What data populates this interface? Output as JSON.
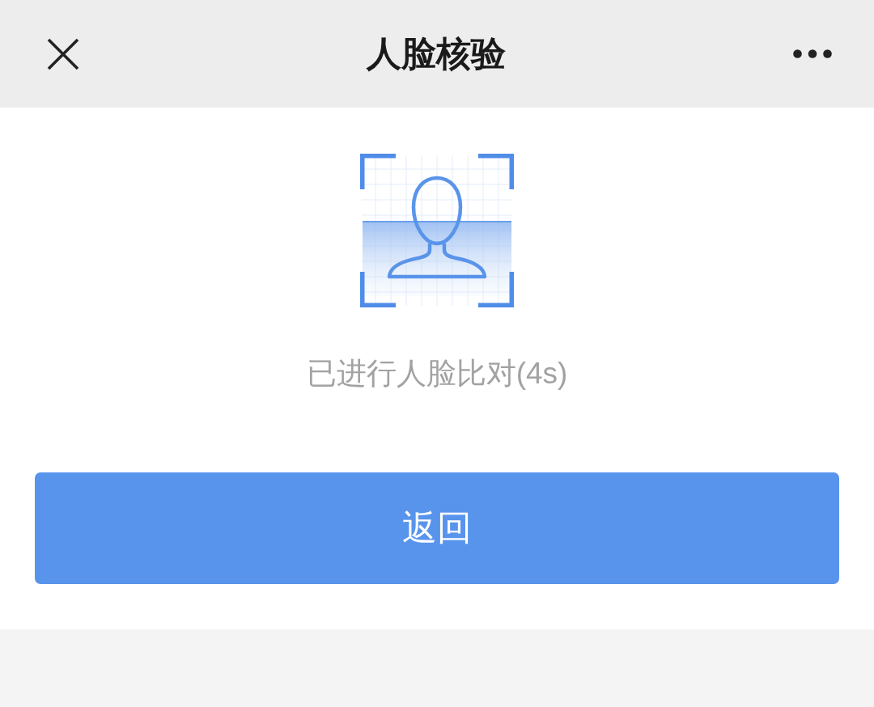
{
  "header": {
    "title": "人脸核验"
  },
  "verification": {
    "status": "已进行人脸比对(4s)"
  },
  "button": {
    "label": "返回"
  }
}
